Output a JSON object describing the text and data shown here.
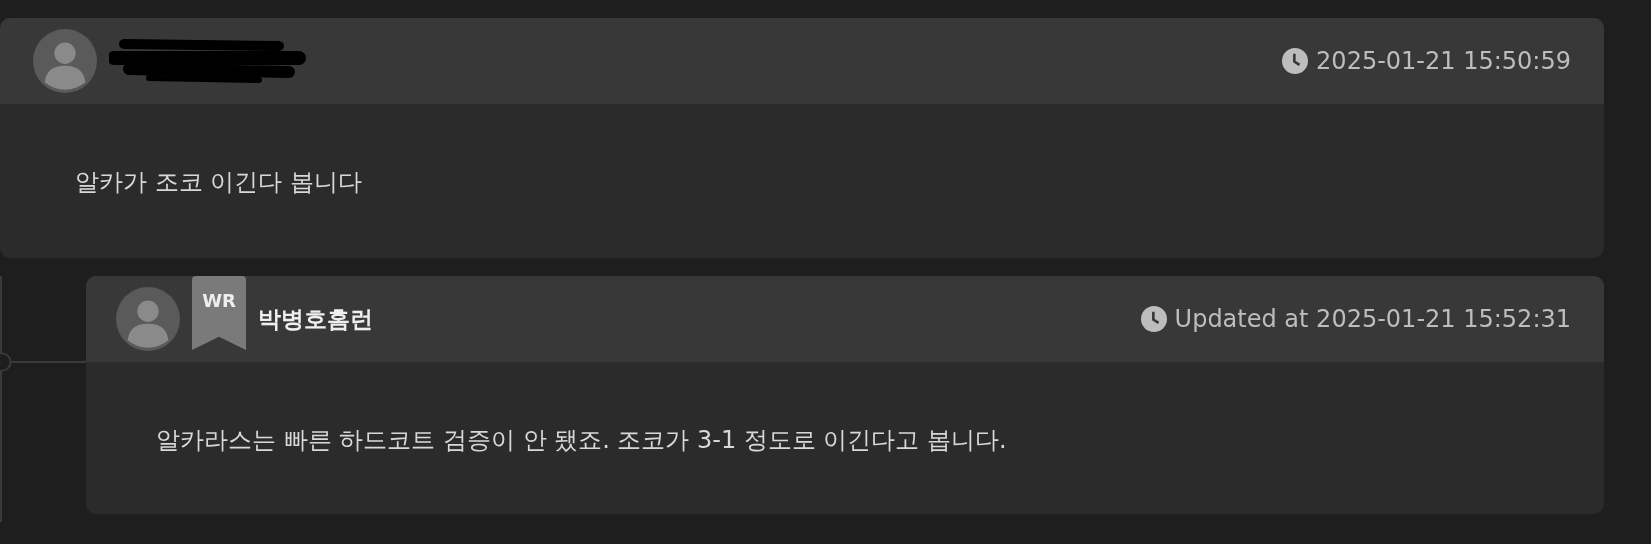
{
  "comments": [
    {
      "author": {
        "redacted": true
      },
      "time": "2025-01-21 15:50:59",
      "text": "알카가 조코 이긴다 봅니다",
      "children": [
        {
          "author": {
            "name": "박병호홈런",
            "badge": "WR"
          },
          "time": "Updated at 2025-01-21 15:52:31",
          "text": "알카라스는 빠른 하드코트 검증이 안 됐죠. 조코가 3-1 정도로 이긴다고 봅니다."
        }
      ]
    }
  ]
}
